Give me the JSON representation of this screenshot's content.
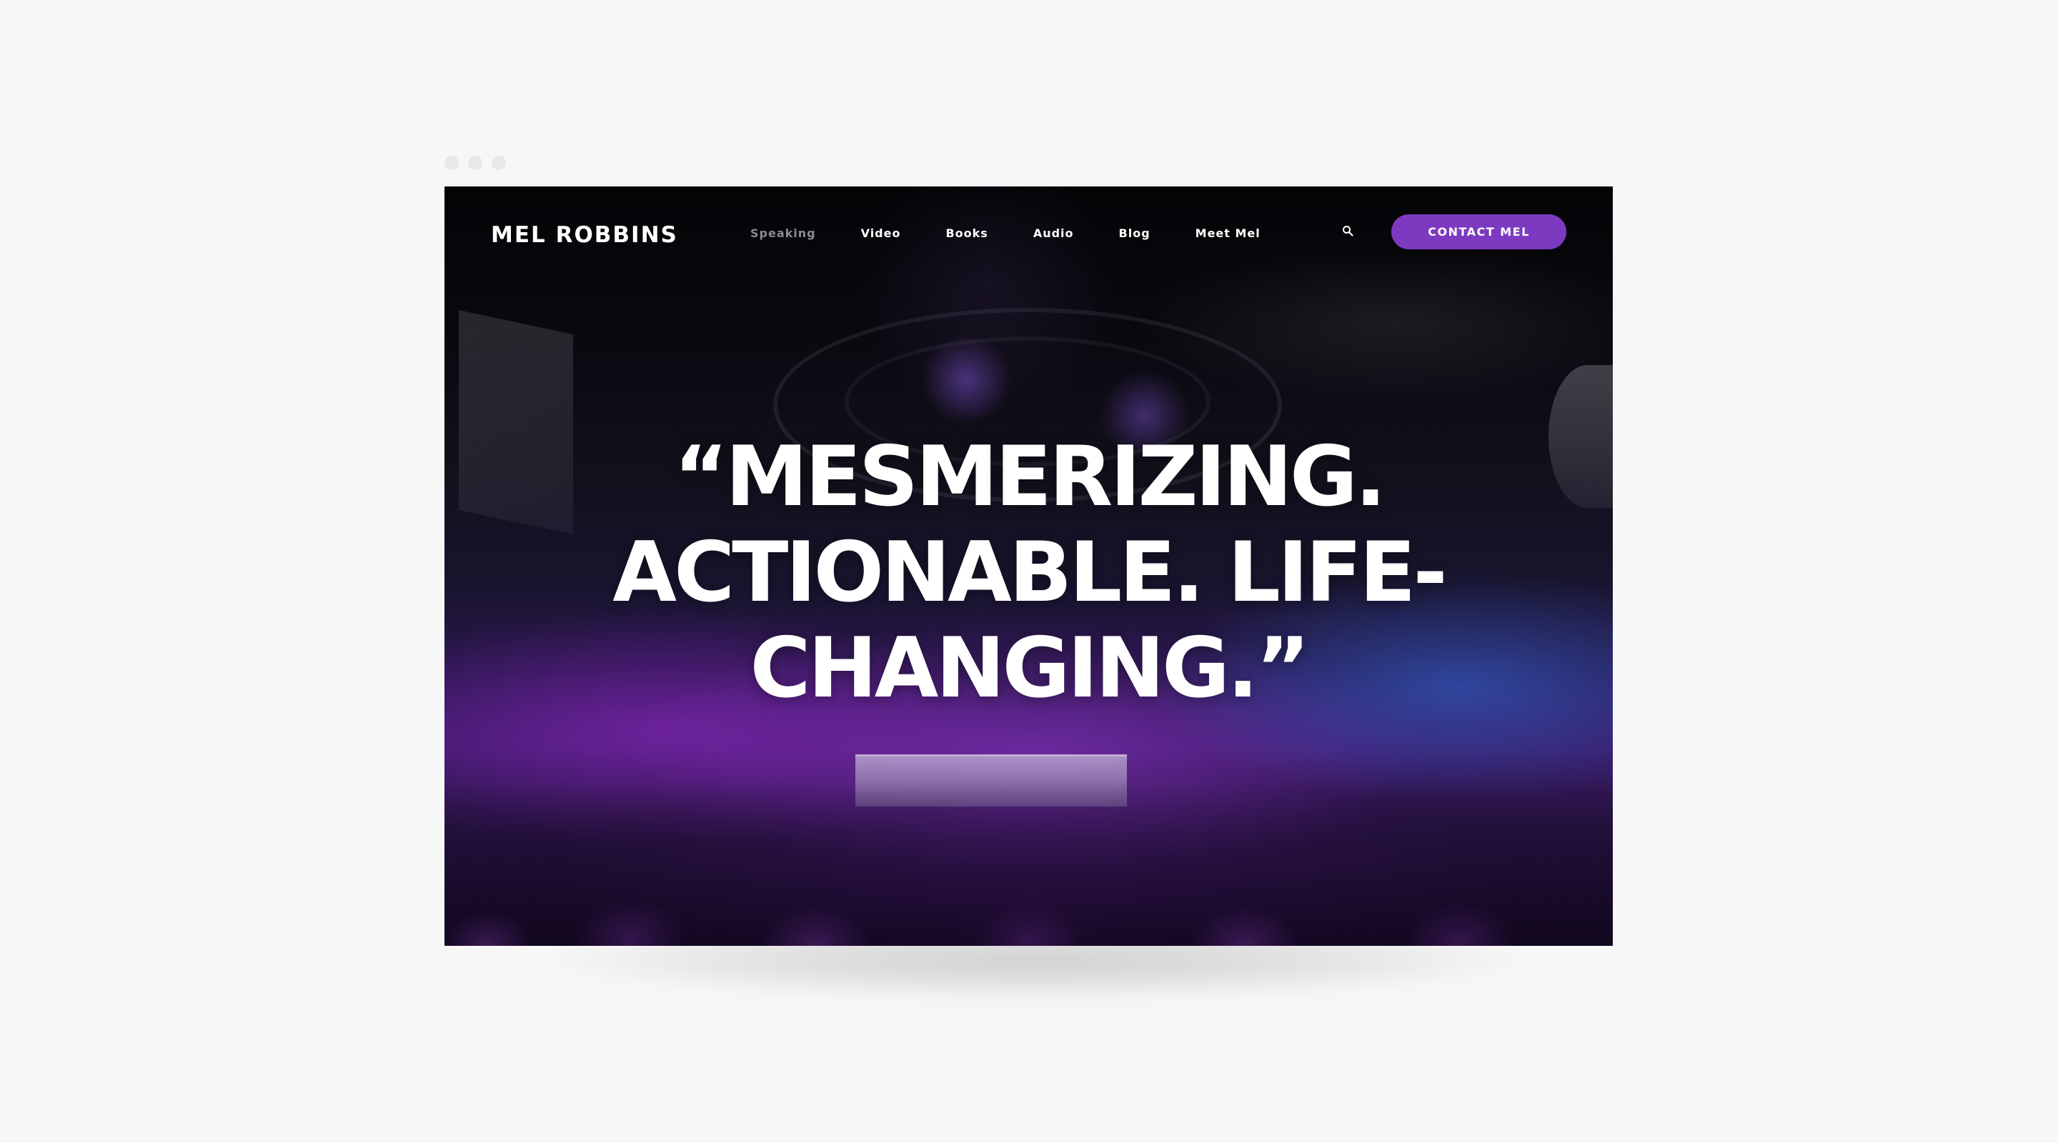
{
  "site": {
    "logo": "MEL ROBBINS"
  },
  "nav": {
    "items": [
      {
        "label": "Speaking",
        "active": false,
        "muted": true
      },
      {
        "label": "Video",
        "active": false,
        "muted": false
      },
      {
        "label": "Books",
        "active": false,
        "muted": false
      },
      {
        "label": "Audio",
        "active": false,
        "muted": false
      },
      {
        "label": "Blog",
        "active": false,
        "muted": false
      },
      {
        "label": "Meet Mel",
        "active": false,
        "muted": false
      }
    ],
    "search_icon": "search-icon",
    "cta_label": "CONTACT MEL"
  },
  "hero": {
    "quote_lines": [
      "“MESMERIZING.",
      "ACTIONABLE. LIFE-",
      "CHANGING.”"
    ]
  },
  "colors": {
    "accent": "#7d3ac1",
    "page_background": "#f7f7f7",
    "nav_muted": "#8d8b92",
    "text": "#ffffff"
  }
}
